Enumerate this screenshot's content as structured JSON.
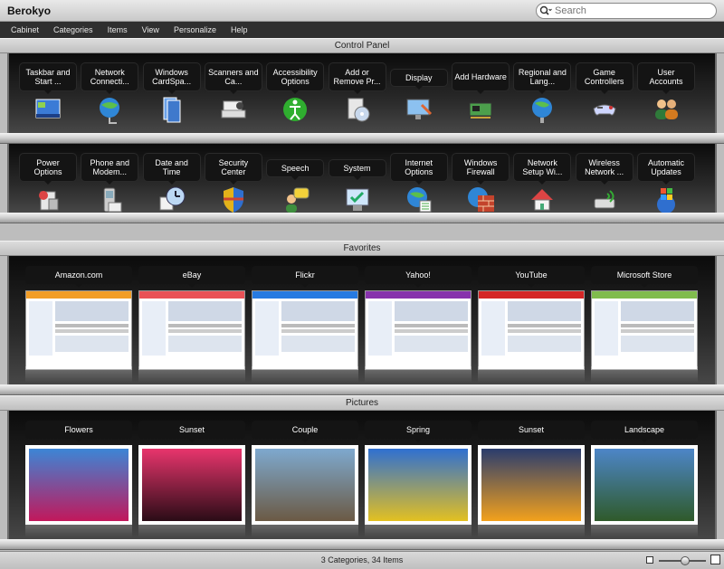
{
  "app": {
    "title": "Berokyo"
  },
  "search": {
    "placeholder": "Search"
  },
  "menu": [
    "Cabinet",
    "Categories",
    "Items",
    "View",
    "Personalize",
    "Help"
  ],
  "sections": {
    "control_panel": "Control Panel",
    "favorites": "Favorites",
    "pictures": "Pictures"
  },
  "control_panel_row1": [
    {
      "label": "Taskbar and Start ...",
      "icon": "taskbar-icon"
    },
    {
      "label": "Network Connecti...",
      "icon": "network-globe-icon"
    },
    {
      "label": "Windows CardSpa...",
      "icon": "cardspace-icon"
    },
    {
      "label": "Scanners and Ca...",
      "icon": "scanner-icon"
    },
    {
      "label": "Accessibility Options",
      "icon": "accessibility-icon"
    },
    {
      "label": "Add or Remove Pr...",
      "icon": "add-remove-programs-icon"
    },
    {
      "label": "Display",
      "icon": "display-icon"
    },
    {
      "label": "Add Hardware",
      "icon": "hardware-icon"
    },
    {
      "label": "Regional and Lang...",
      "icon": "regional-globe-icon"
    },
    {
      "label": "Game Controllers",
      "icon": "gamepad-icon"
    },
    {
      "label": "User Accounts",
      "icon": "users-icon"
    }
  ],
  "control_panel_row2": [
    {
      "label": "Power Options",
      "icon": "power-icon"
    },
    {
      "label": "Phone and Modem...",
      "icon": "phone-icon"
    },
    {
      "label": "Date and Time",
      "icon": "clock-icon"
    },
    {
      "label": "Security Center",
      "icon": "shield-icon"
    },
    {
      "label": "Speech",
      "icon": "speech-icon"
    },
    {
      "label": "System",
      "icon": "system-icon"
    },
    {
      "label": "Internet Options",
      "icon": "internet-globe-icon"
    },
    {
      "label": "Windows Firewall",
      "icon": "firewall-icon"
    },
    {
      "label": "Network Setup Wi...",
      "icon": "network-house-icon"
    },
    {
      "label": "Wireless Network ...",
      "icon": "wireless-icon"
    },
    {
      "label": "Automatic Updates",
      "icon": "windows-update-icon"
    }
  ],
  "favorites": [
    {
      "label": "Amazon.com",
      "accent": "#f08c00"
    },
    {
      "label": "eBay",
      "accent": "#e53238"
    },
    {
      "label": "Flickr",
      "accent": "#0063dc"
    },
    {
      "label": "Yahoo!",
      "accent": "#720e9e"
    },
    {
      "label": "YouTube",
      "accent": "#cc0000"
    },
    {
      "label": "Microsoft Store",
      "accent": "#6ab02e"
    }
  ],
  "pictures": [
    {
      "label": "Flowers",
      "colors": [
        "#3c86d6",
        "#c2185b"
      ]
    },
    {
      "label": "Sunset",
      "colors": [
        "#e8356d",
        "#2a0c16"
      ]
    },
    {
      "label": "Couple",
      "colors": [
        "#7ea9cf",
        "#6b5a44"
      ]
    },
    {
      "label": "Spring",
      "colors": [
        "#2f6fd1",
        "#e3c021"
      ]
    },
    {
      "label": "Sunset",
      "colors": [
        "#2a3c6e",
        "#f3a11c"
      ]
    },
    {
      "label": "Landscape",
      "colors": [
        "#4d86c8",
        "#2f5a2a"
      ]
    }
  ],
  "status": {
    "text": "3 Categories, 34 Items",
    "zoom_level": 0.55
  }
}
